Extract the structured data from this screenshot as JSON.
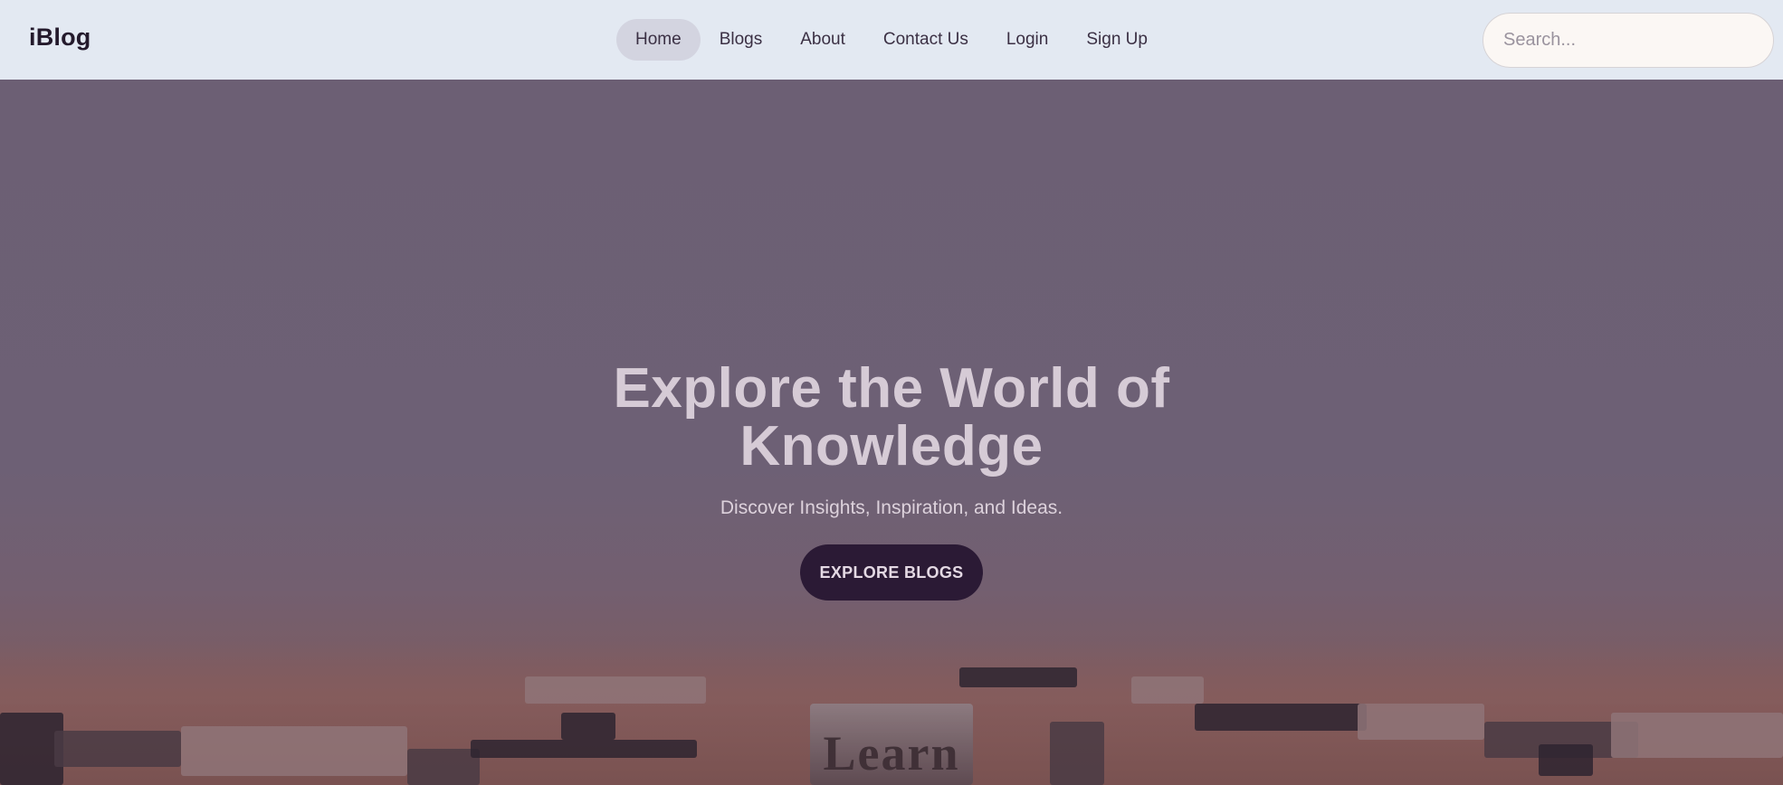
{
  "navbar": {
    "brand": "iBlog",
    "links": [
      {
        "label": "Home",
        "active": true
      },
      {
        "label": "Blogs",
        "active": false
      },
      {
        "label": "About",
        "active": false
      },
      {
        "label": "Contact Us",
        "active": false
      },
      {
        "label": "Login",
        "active": false
      },
      {
        "label": "Sign Up",
        "active": false
      }
    ],
    "search": {
      "placeholder": "Search...",
      "value": ""
    }
  },
  "hero": {
    "title": "Explore the World of Knowledge",
    "subtitle": "Discover Insights, Inspiration, and Ideas.",
    "cta_label": "EXPLORE BLOGS",
    "background_image_text": "Learn"
  },
  "colors": {
    "navbar_bg": "#e3e9f2",
    "active_link_bg": "#d3d4e0",
    "hero_overlay": "#6c5f74",
    "cta_bg": "#2b1a35",
    "search_bg": "#fbf7f4"
  }
}
